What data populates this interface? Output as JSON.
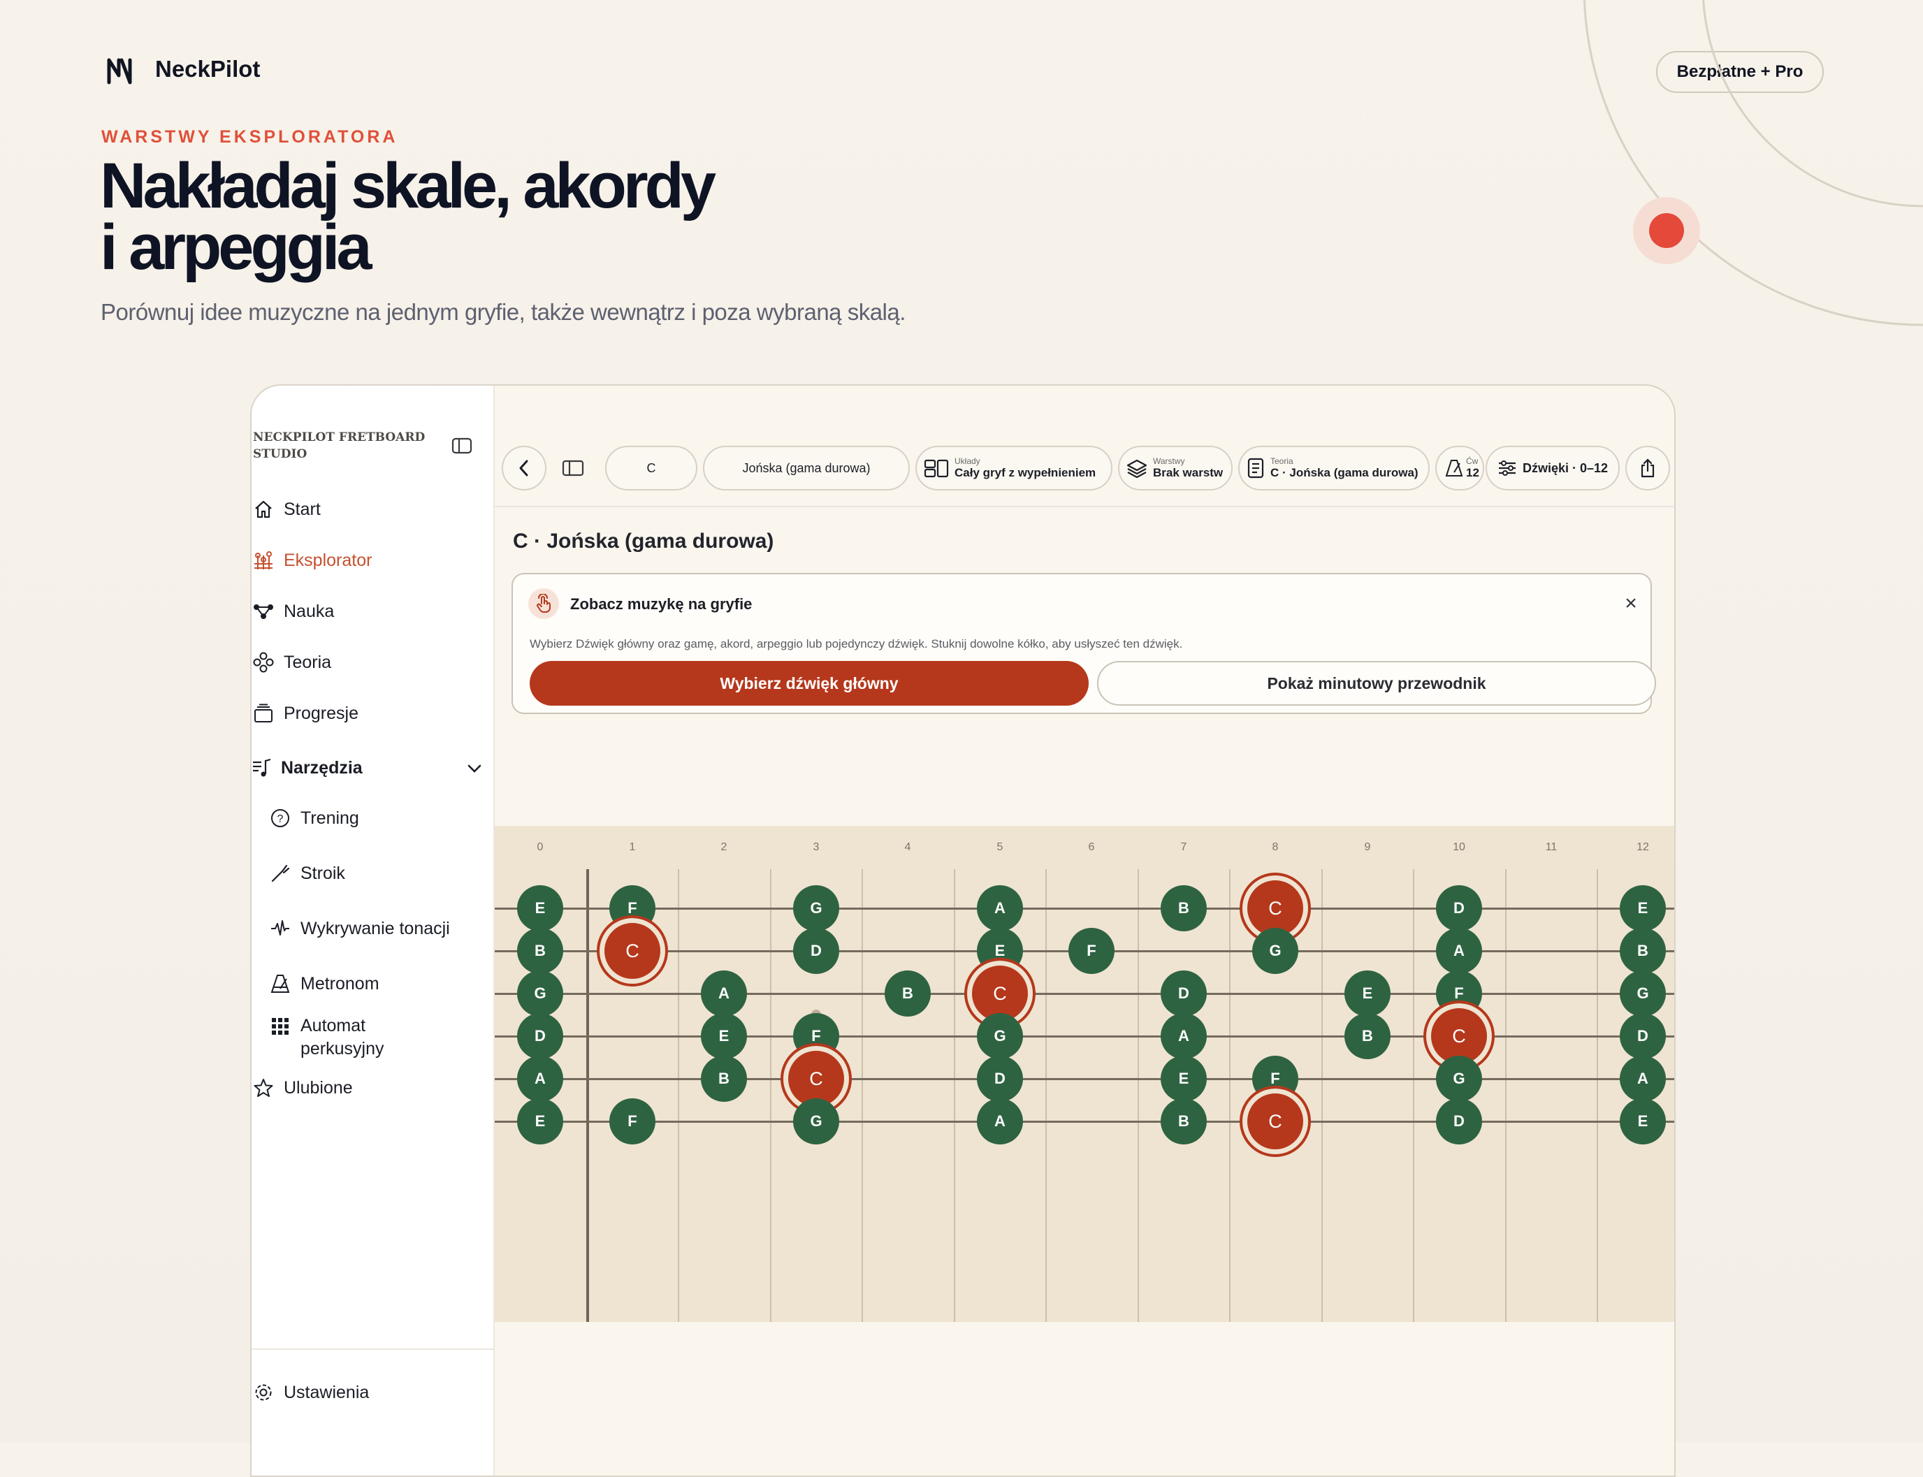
{
  "header": {
    "brand": "NeckPilot",
    "pricing_pill": "Bezpłatne + Pro",
    "eyebrow": "WARSTWY EKSPLORATORA",
    "headline_line1": "Nakładaj skale, akordy",
    "headline_line2": "i arpeggia",
    "subline": "Porównuj idee muzyczne na jednym gryfie, także wewnątrz i poza wybraną skalą."
  },
  "sidebar": {
    "title": "NECKPILOT FRETBOARD STUDIO",
    "items": [
      {
        "label": "Start",
        "icon": "home-icon"
      },
      {
        "label": "Eksplorator",
        "icon": "explorer-icon",
        "active": true
      },
      {
        "label": "Nauka",
        "icon": "nodes-icon"
      },
      {
        "label": "Teoria",
        "icon": "circles-icon"
      },
      {
        "label": "Progresje",
        "icon": "stack-icon"
      }
    ],
    "tools_label": "Narzędzia",
    "tools": [
      {
        "label": "Trening",
        "icon": "question-icon"
      },
      {
        "label": "Stroik",
        "icon": "tuner-icon"
      },
      {
        "label": "Wykrywanie tonacji",
        "icon": "waveform-icon"
      },
      {
        "label": "Metronom",
        "icon": "metronome-icon"
      },
      {
        "label_line1": "Automat",
        "label_line2": "perkusyjny",
        "icon": "grid-icon"
      }
    ],
    "favorites": "Ulubione",
    "settings": "Ustawienia"
  },
  "toolbar": {
    "root": "C",
    "scale": "Jońska (gama durowa)",
    "layouts_small": "Układy",
    "layouts_big": "Cały gryf z wypełnieniem",
    "layers_small": "Warstwy",
    "layers_big": "Brak warstw",
    "theory_small": "Teoria",
    "theory_big": "C · Jońska (gama durowa)",
    "exercise_small": "Ćw",
    "exercise_big": "12",
    "notes_range": "Dźwięki · 0–12"
  },
  "content": {
    "page_title": "C · Jońska (gama durowa)",
    "card_title": "Zobacz muzykę na gryfie",
    "card_desc": "Wybierz Dźwięk główny oraz gamę, akord, arpeggio lub pojedynczy dźwięk. Stuknij dowolne kółko, aby usłyszeć ten dźwięk.",
    "primary_button": "Wybierz dźwięk główny",
    "secondary_button": "Pokaż minutowy przewodnik",
    "close_glyph": "×"
  },
  "fretboard": {
    "fret_numbers": [
      "0",
      "1",
      "2",
      "3",
      "4",
      "5",
      "6",
      "7",
      "8",
      "9",
      "10",
      "11",
      "12"
    ],
    "root_note": "C",
    "inlay_frets": [
      3,
      5,
      7,
      9,
      12
    ],
    "strings": [
      {
        "name": "E",
        "notes": [
          [
            0,
            "E"
          ],
          [
            1,
            "F"
          ],
          [
            3,
            "G"
          ],
          [
            5,
            "A"
          ],
          [
            7,
            "B"
          ],
          [
            8,
            "C"
          ],
          [
            10,
            "D"
          ],
          [
            12,
            "E"
          ]
        ]
      },
      {
        "name": "B",
        "notes": [
          [
            0,
            "B"
          ],
          [
            1,
            "C"
          ],
          [
            3,
            "D"
          ],
          [
            5,
            "E"
          ],
          [
            6,
            "F"
          ],
          [
            8,
            "G"
          ],
          [
            10,
            "A"
          ],
          [
            12,
            "B"
          ]
        ]
      },
      {
        "name": "G",
        "notes": [
          [
            0,
            "G"
          ],
          [
            2,
            "A"
          ],
          [
            4,
            "B"
          ],
          [
            5,
            "C"
          ],
          [
            7,
            "D"
          ],
          [
            9,
            "E"
          ],
          [
            10,
            "F"
          ],
          [
            12,
            "G"
          ]
        ]
      },
      {
        "name": "D",
        "notes": [
          [
            0,
            "D"
          ],
          [
            2,
            "E"
          ],
          [
            3,
            "F"
          ],
          [
            5,
            "G"
          ],
          [
            7,
            "A"
          ],
          [
            9,
            "B"
          ],
          [
            10,
            "C"
          ],
          [
            12,
            "D"
          ]
        ]
      },
      {
        "name": "A",
        "notes": [
          [
            0,
            "A"
          ],
          [
            2,
            "B"
          ],
          [
            3,
            "C"
          ],
          [
            5,
            "D"
          ],
          [
            7,
            "E"
          ],
          [
            8,
            "F"
          ],
          [
            10,
            "G"
          ],
          [
            12,
            "A"
          ]
        ]
      },
      {
        "name": "E",
        "notes": [
          [
            0,
            "E"
          ],
          [
            1,
            "F"
          ],
          [
            3,
            "G"
          ],
          [
            5,
            "A"
          ],
          [
            7,
            "B"
          ],
          [
            8,
            "C"
          ],
          [
            10,
            "D"
          ],
          [
            12,
            "E"
          ]
        ]
      }
    ]
  },
  "colors": {
    "accent": "#e0503a",
    "root": "#b5381c",
    "note": "#2e6342",
    "fretboard": "#efe4d1"
  }
}
